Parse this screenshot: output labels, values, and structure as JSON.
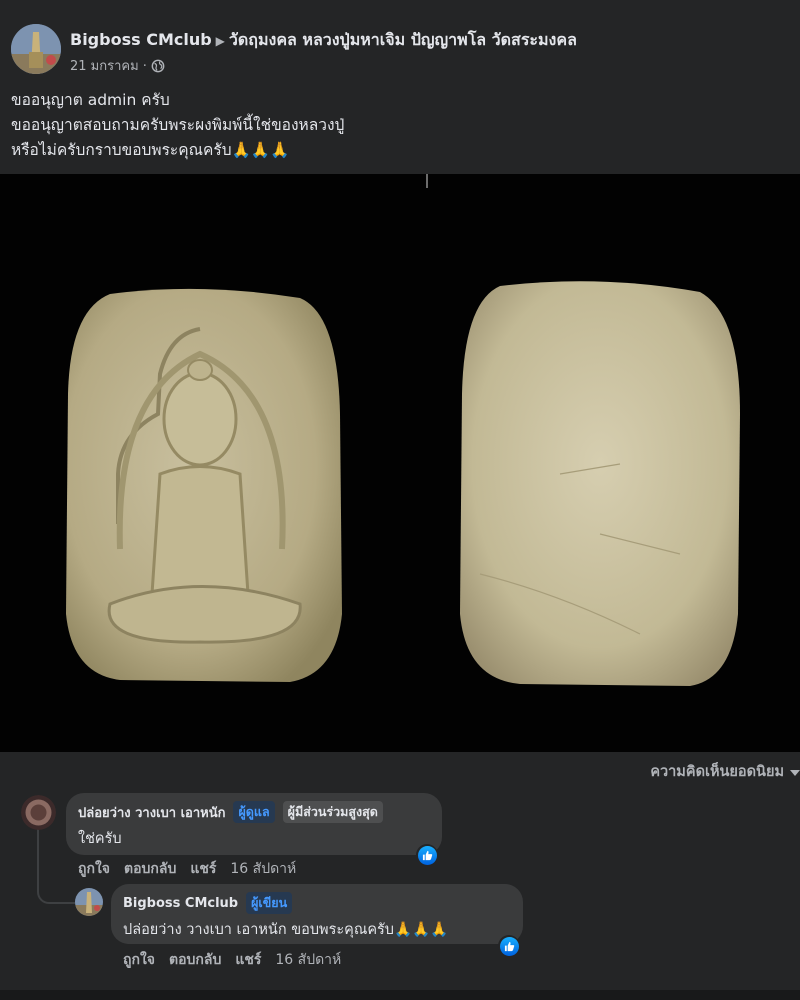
{
  "header": {
    "author": "Bigboss CMclub",
    "group": "วัดฤมงคล หลวงปู่มหาเจิม ปัญญาพโล วัดสระมงคล",
    "date": "21 มกราคม ·",
    "privacy_icon": "globe-icon"
  },
  "post": {
    "lines": [
      "ขออนุญาต admin ครับ",
      "ขออนุญาตสอบถามครับพระผงพิมพ์นี้ใช่ของหลวงปู่",
      "หรือไม่ครับกราบขอบพระคุณครับ🙏🙏🙏"
    ]
  },
  "photo": {
    "description_icons": [
      "amulet-front",
      "amulet-back"
    ]
  },
  "comments": {
    "sort_label": "ความคิดเห็นยอดนิยม",
    "items": [
      {
        "author": "ปล่อยว่าง วางเบา เอาหนัก",
        "badges": [
          "ผู้ดูแล",
          "ผู้มีส่วนร่วมสูงสุด"
        ],
        "text": "ใช่ครับ",
        "actions": [
          "ถูกใจ",
          "ตอบกลับ",
          "แชร์"
        ],
        "time": "16 สัปดาห์"
      },
      {
        "author": "Bigboss CMclub",
        "badges": [
          "ผู้เขียน"
        ],
        "text": "ปล่อยว่าง วางเบา เอาหนัก ขอบพระคุณครับ🙏🙏🙏",
        "actions": [
          "ถูกใจ",
          "ตอบกลับ",
          "แชร์"
        ],
        "time": "16 สัปดาห์"
      }
    ]
  },
  "colors": {
    "background": "#242526",
    "accent": "#4599ff",
    "like_blue": "#0a7cff"
  }
}
